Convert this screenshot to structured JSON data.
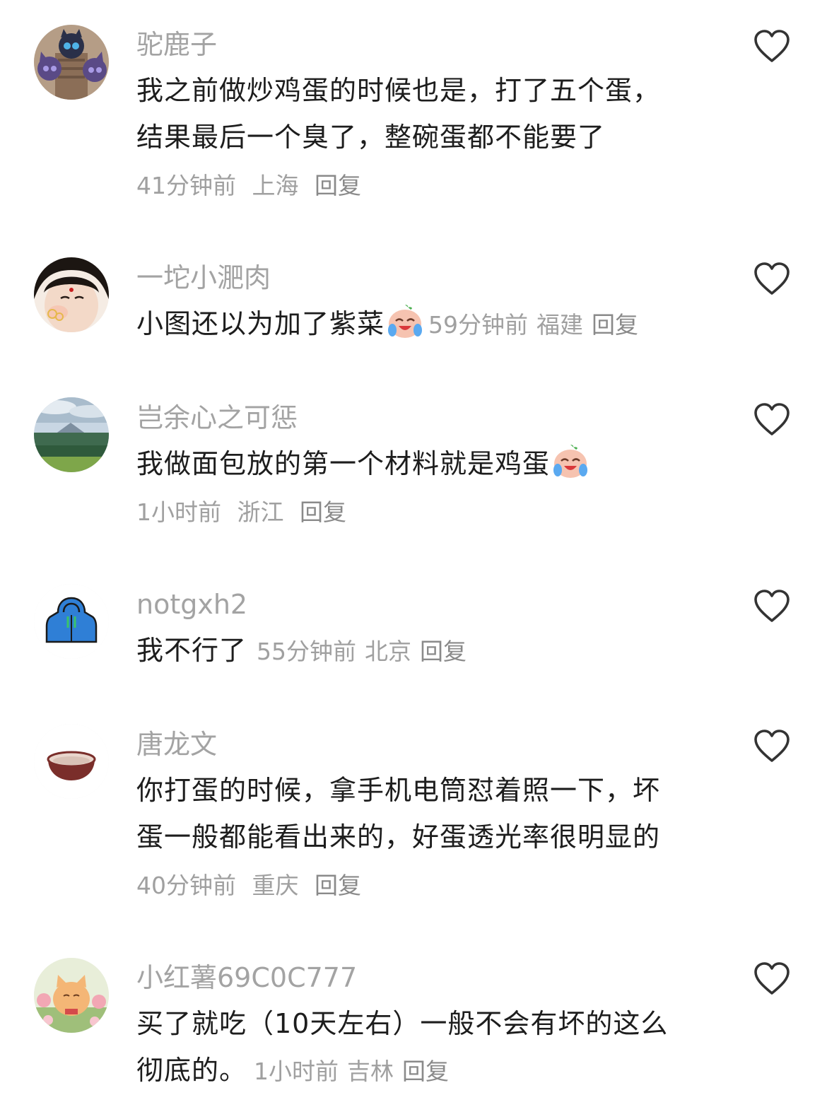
{
  "comments": [
    {
      "name": "驼鹿子",
      "text_lines": [
        "我之前做炒鸡蛋的时候也是，打了五个蛋，",
        "结果最后一个臭了，整碗蛋都不能要了"
      ],
      "time": "41分钟前",
      "location": "上海",
      "reply": "回复",
      "avatar": "cats-avatar"
    },
    {
      "name": "一坨小淝肉",
      "text": "小图还以为加了紫菜",
      "emoji": "crying-laughing-emoji",
      "time": "59分钟前",
      "location": "福建",
      "reply": "回复",
      "avatar": "girl-avatar"
    },
    {
      "name": "岂余心之可惩",
      "text": "我做面包放的第一个材料就是鸡蛋",
      "emoji": "crying-laughing-emoji",
      "time": "1小时前",
      "location": "浙江",
      "reply": "回复",
      "avatar": "landscape-avatar"
    },
    {
      "name": "notgxh2",
      "text": "我不行了",
      "time": "55分钟前",
      "location": "北京",
      "reply": "回复",
      "avatar": "hoodie-avatar"
    },
    {
      "name": "唐龙文",
      "text_lines": [
        "你打蛋的时候，拿手机电筒怼着照一下，坏",
        "蛋一般都能看出来的，好蛋透光率很明显的"
      ],
      "time": "40分钟前",
      "location": "重庆",
      "reply": "回复",
      "avatar": "bowl-avatar"
    },
    {
      "name": "小红薯69C0C777",
      "text_lines": [
        "买了就吃（10天左右）一般不会有坏的这么",
        "彻底的。"
      ],
      "time": "1小时前",
      "location": "吉林",
      "reply": "回复",
      "avatar": "cat-flower-avatar"
    }
  ],
  "colors": {
    "name": "#a3a3a3",
    "text": "#1d1d1d",
    "meta": "#a0a0a0",
    "heart": "#333333"
  }
}
